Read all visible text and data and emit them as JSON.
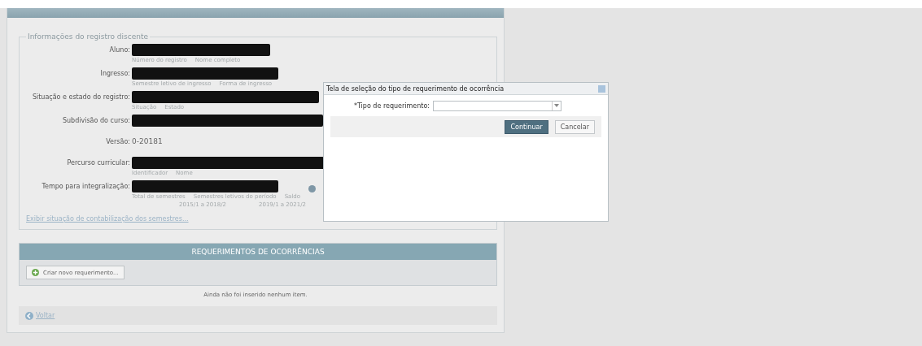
{
  "registro": {
    "legend": "Informações do registro discente",
    "rows": [
      {
        "label": "Aluno:",
        "kind": "redacted",
        "captions": [
          "Número do registro",
          "Nome completo"
        ]
      },
      {
        "label": "Ingresso:",
        "kind": "redacted",
        "captions": [
          "Semestre letivo de ingresso",
          "Forma de ingresso"
        ]
      },
      {
        "label": "Situação e estado do registro:",
        "kind": "redacted",
        "captions": [
          "Situação",
          "Estado"
        ]
      },
      {
        "label": "Subdivisão do curso:",
        "kind": "redacted",
        "captions": []
      },
      {
        "label": "Versão:",
        "kind": "text",
        "value": "0-20181"
      },
      {
        "label": "Percurso curricular:",
        "kind": "redacted",
        "captions": [
          "Identificador",
          "Nome"
        ]
      },
      {
        "label": "Tempo para integralização:",
        "kind": "redacted",
        "captions": [
          "Total de semestres",
          "Semestres letivos do período",
          "Saldo"
        ],
        "subvalues": [
          "2015/1 a 2018/2",
          "2019/1 a 2021/2"
        ],
        "info": true
      }
    ],
    "link": "Exibir situação de contabilização dos semestres..."
  },
  "requerimentos": {
    "title": "REQUERIMENTOS DE OCORRÊNCIAS",
    "new_button": "Criar novo requerimento...",
    "empty": "Ainda não foi inserido nenhum item."
  },
  "back_link": "Voltar",
  "dialog": {
    "title": "Tela de seleção do tipo de requerimento de ocorrência",
    "field_label": "*Tipo de requerimento:",
    "buttons": [
      {
        "label": "Continuar",
        "primary": true
      },
      {
        "label": "Cancelar",
        "primary": false
      }
    ]
  }
}
